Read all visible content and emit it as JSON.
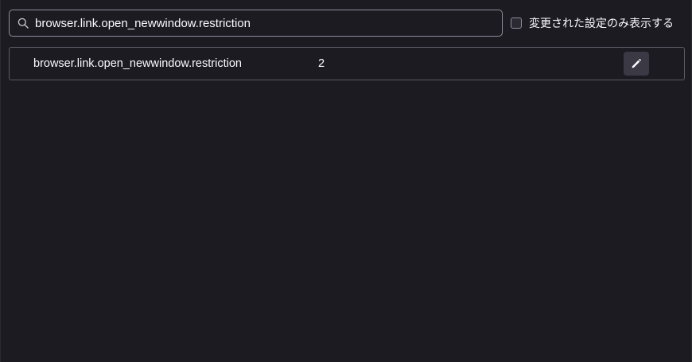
{
  "search": {
    "value": "browser.link.open_newwindow.restriction",
    "icon": "search-icon"
  },
  "filter": {
    "label": "変更された設定のみ表示する",
    "checked": false
  },
  "preferences": [
    {
      "name": "browser.link.open_newwindow.restriction",
      "value": "2",
      "action_icon": "pencil-icon"
    }
  ],
  "colors": {
    "background": "#1c1b22",
    "text": "#fbfbfe",
    "border": "#8f8f9d",
    "button": "#3a3944"
  }
}
